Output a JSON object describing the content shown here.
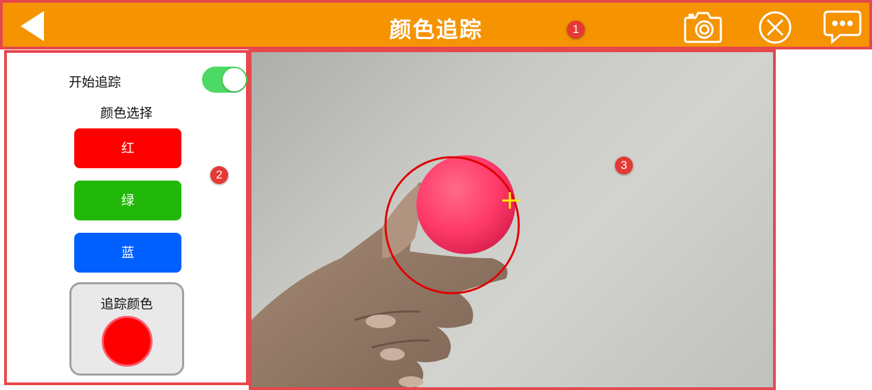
{
  "header": {
    "title": "颜色追踪",
    "background_color": "#f59300",
    "icons": [
      "back-arrow-icon",
      "camera-icon",
      "close-circle-icon",
      "chat-bubble-icon"
    ]
  },
  "annotations": {
    "badge_1": "1",
    "badge_2": "2",
    "badge_3": "3",
    "badge_color": "#e53935"
  },
  "sidebar": {
    "tracking_label": "开始追踪",
    "tracking_enabled": true,
    "color_select_label": "颜色选择",
    "buttons": [
      {
        "label": "红",
        "color": "#ff0000"
      },
      {
        "label": "绿",
        "color": "#22b80a"
      },
      {
        "label": "蓝",
        "color": "#0060ff"
      }
    ],
    "tracked_color_label": "追踪颜色",
    "tracked_color": "#ff0000"
  },
  "camera": {
    "detection_circle_color": "#e00000",
    "crosshair_color": "#ffee00",
    "ball_color": "#ff3a6a"
  }
}
